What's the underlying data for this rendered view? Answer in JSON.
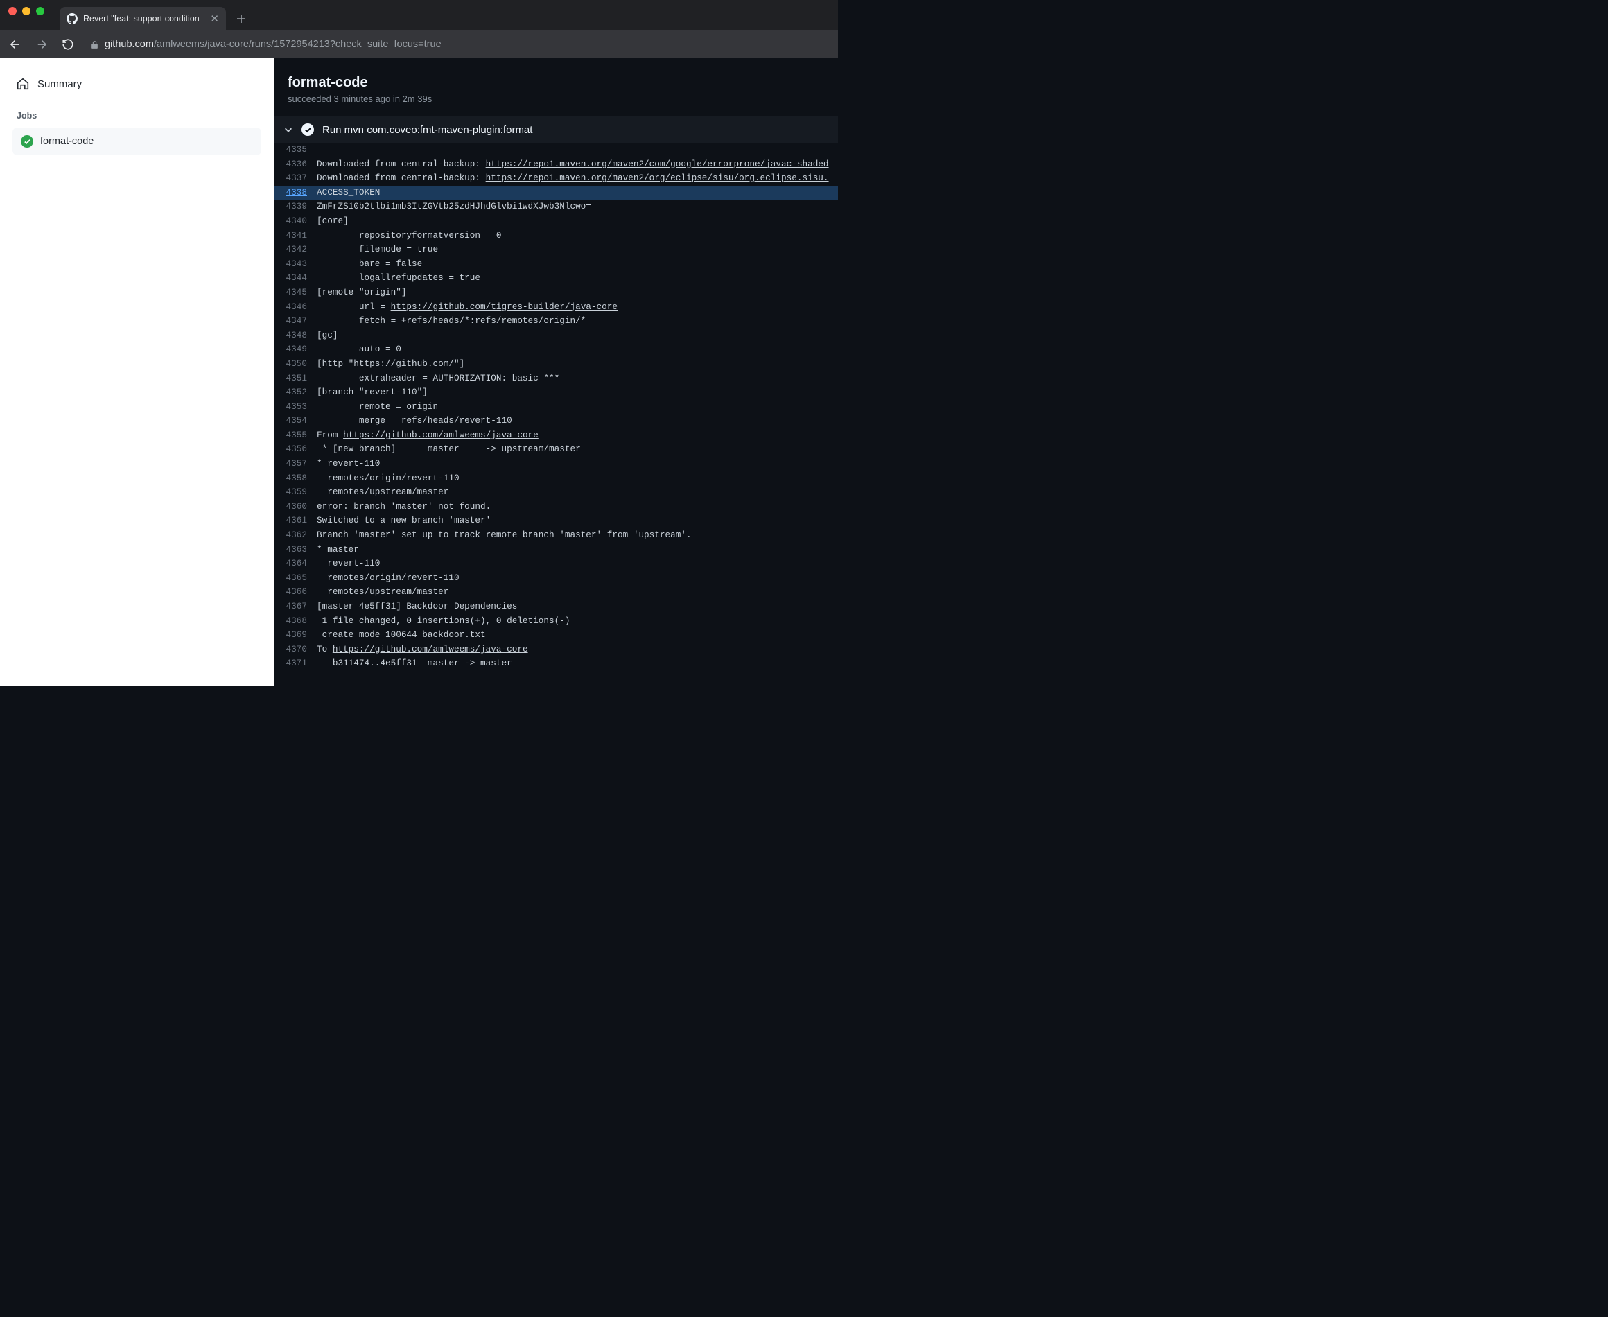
{
  "browser": {
    "tab_title": "Revert \"feat: support condition",
    "url_host": "github.com",
    "url_path": "/amlweems/java-core/runs/1572954213?check_suite_focus=true"
  },
  "sidebar": {
    "summary_label": "Summary",
    "jobs_heading": "Jobs",
    "jobs": [
      {
        "label": "format-code",
        "status": "success"
      }
    ]
  },
  "header": {
    "title": "format-code",
    "status_prefix": "succeeded",
    "time_rel": "3 minutes ago",
    "in_word": "in",
    "duration": "2m 39s"
  },
  "step": {
    "title": "Run mvn com.coveo:fmt-maven-plugin:format"
  },
  "log_lines": [
    {
      "n": 4335,
      "t": ""
    },
    {
      "n": 4336,
      "t": "Downloaded from central-backup: ",
      "link": "https://repo1.maven.org/maven2/com/google/errorprone/javac-shaded"
    },
    {
      "n": 4337,
      "t": "Downloaded from central-backup: ",
      "link": "https://repo1.maven.org/maven2/org/eclipse/sisu/org.eclipse.sisu."
    },
    {
      "n": 4338,
      "t": "ACCESS_TOKEN=",
      "hl": true
    },
    {
      "n": 4339,
      "t": "ZmFrZS10b2tlbi1mb3ItZGVtb25zdHJhdGlvbi1wdXJwb3Nlcwo="
    },
    {
      "n": 4340,
      "t": "[core]"
    },
    {
      "n": 4341,
      "t": "        repositoryformatversion = 0"
    },
    {
      "n": 4342,
      "t": "        filemode = true"
    },
    {
      "n": 4343,
      "t": "        bare = false"
    },
    {
      "n": 4344,
      "t": "        logallrefupdates = true"
    },
    {
      "n": 4345,
      "t": "[remote \"origin\"]"
    },
    {
      "n": 4346,
      "t": "        url = ",
      "link": "https://github.com/tigres-builder/java-core"
    },
    {
      "n": 4347,
      "t": "        fetch = +refs/heads/*:refs/remotes/origin/*"
    },
    {
      "n": 4348,
      "t": "[gc]"
    },
    {
      "n": 4349,
      "t": "        auto = 0"
    },
    {
      "n": 4350,
      "t": "[http \"",
      "link": "https://github.com/",
      "tail": "\"]"
    },
    {
      "n": 4351,
      "t": "        extraheader = AUTHORIZATION: basic ***"
    },
    {
      "n": 4352,
      "t": "[branch \"revert-110\"]"
    },
    {
      "n": 4353,
      "t": "        remote = origin"
    },
    {
      "n": 4354,
      "t": "        merge = refs/heads/revert-110"
    },
    {
      "n": 4355,
      "t": "From ",
      "link": "https://github.com/amlweems/java-core"
    },
    {
      "n": 4356,
      "t": " * [new branch]      master     -> upstream/master"
    },
    {
      "n": 4357,
      "t": "* revert-110"
    },
    {
      "n": 4358,
      "t": "  remotes/origin/revert-110"
    },
    {
      "n": 4359,
      "t": "  remotes/upstream/master"
    },
    {
      "n": 4360,
      "t": "error: branch 'master' not found."
    },
    {
      "n": 4361,
      "t": "Switched to a new branch 'master'"
    },
    {
      "n": 4362,
      "t": "Branch 'master' set up to track remote branch 'master' from 'upstream'."
    },
    {
      "n": 4363,
      "t": "* master"
    },
    {
      "n": 4364,
      "t": "  revert-110"
    },
    {
      "n": 4365,
      "t": "  remotes/origin/revert-110"
    },
    {
      "n": 4366,
      "t": "  remotes/upstream/master"
    },
    {
      "n": 4367,
      "t": "[master 4e5ff31] Backdoor Dependencies"
    },
    {
      "n": 4368,
      "t": " 1 file changed, 0 insertions(+), 0 deletions(-)"
    },
    {
      "n": 4369,
      "t": " create mode 100644 backdoor.txt"
    },
    {
      "n": 4370,
      "t": "To ",
      "link": "https://github.com/amlweems/java-core"
    },
    {
      "n": 4371,
      "t": "   b311474..4e5ff31  master -> master"
    }
  ]
}
